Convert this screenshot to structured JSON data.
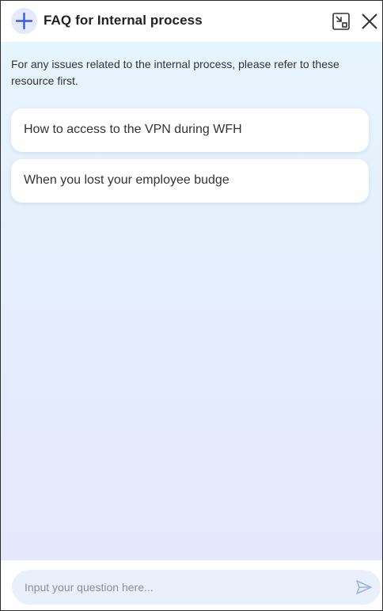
{
  "header": {
    "title": "FAQ for Internal process",
    "new_chat_icon": "plus-icon",
    "minimize_icon": "minimize-window-icon",
    "close_icon": "close-icon"
  },
  "intro": {
    "text": "For any issues related to the internal process, please refer to these resource first."
  },
  "faq_items": [
    {
      "label": "How to access to the VPN during WFH"
    },
    {
      "label": "When you lost your employee budge"
    }
  ],
  "composer": {
    "value": "",
    "placeholder": "Input your question here...",
    "send_icon": "send-icon"
  },
  "colors": {
    "accent": "#3d5bd9",
    "icon_bg": "#e4e9fb",
    "body_gradient_top": "#e6f4fd",
    "body_gradient_bottom": "#e4e8fc",
    "input_bg": "#e9f0fc",
    "send_icon": "#9fb3ea"
  }
}
